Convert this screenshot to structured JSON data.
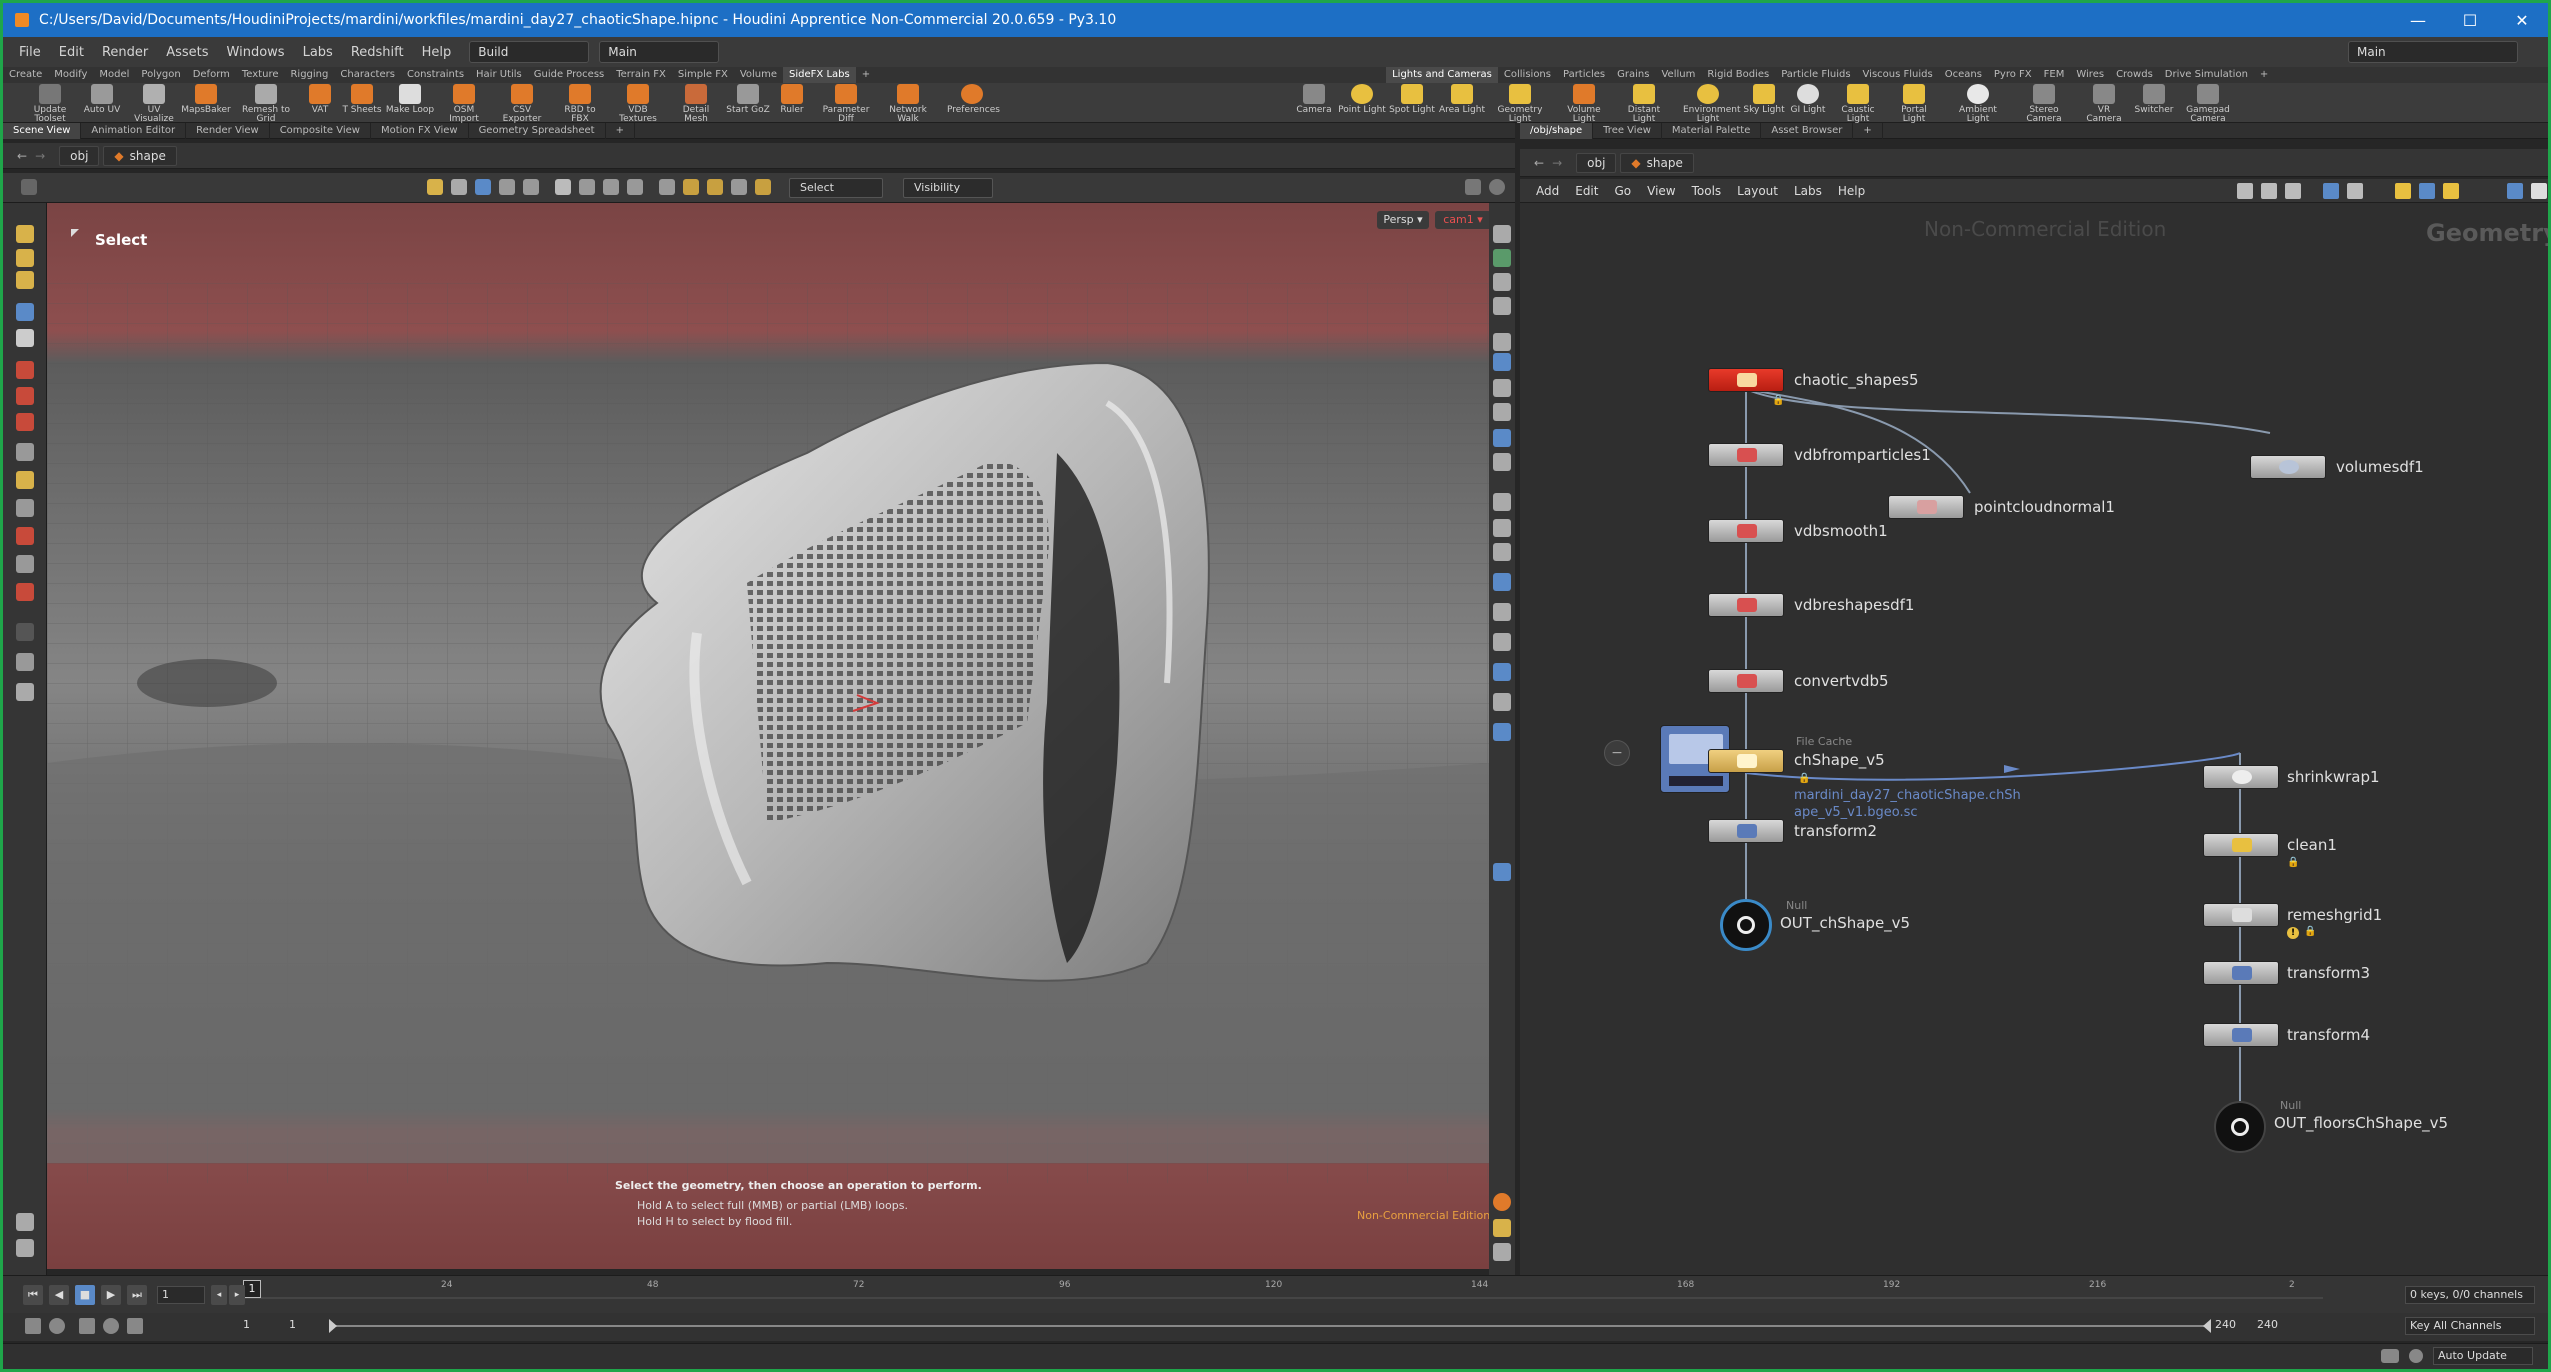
{
  "window": {
    "title": "C:/Users/David/Documents/HoudiniProjects/mardini/workfiles/mardini_day27_chaoticShape.hipnc - Houdini Apprentice Non-Commercial 20.0.659 - Py3.10",
    "minimize": "—",
    "maximize": "☐",
    "close": "✕"
  },
  "menubar": {
    "items": [
      "File",
      "Edit",
      "Render",
      "Assets",
      "Windows",
      "Labs",
      "Redshift",
      "Help"
    ],
    "desktop": "Build",
    "context": "Main",
    "right_context": "Main"
  },
  "shelf": {
    "tabs_left": [
      "Create",
      "Modify",
      "Model",
      "Polygon",
      "Deform",
      "Texture",
      "Rigging",
      "Characters",
      "Constraints",
      "Hair Utils",
      "Guide Process",
      "Terrain FX",
      "Simple FX",
      "Volume",
      "SideFX Labs"
    ],
    "tabs_right": [
      "Lights and Cameras",
      "Collisions",
      "Particles",
      "Grains",
      "Vellum",
      "Rigid Bodies",
      "Particle Fluids",
      "Viscous Fluids",
      "Oceans",
      "Pyro FX",
      "FEM",
      "Wires",
      "Crowds",
      "Drive Simulation"
    ],
    "tools_left": [
      "Update Toolset",
      "Auto UV",
      "UV Visualize",
      "MapsBaker",
      "Remesh to Grid",
      "VAT",
      "T Sheets",
      "Make Loop",
      "OSM Import",
      "CSV Exporter",
      "RBD to FBX",
      "VDB Textures",
      "Detail Mesh",
      "Start GoZ",
      "Ruler",
      "Parameter Diff",
      "Network Walk",
      "Preferences"
    ],
    "tools_right": [
      "Camera",
      "Point Light",
      "Spot Light",
      "Area Light",
      "Geometry Light",
      "Volume Light",
      "Distant Light",
      "Environment Light",
      "Sky Light",
      "GI Light",
      "Caustic Light",
      "Portal Light",
      "Ambient Light",
      "Stereo Camera",
      "VR Camera",
      "Switcher",
      "Gamepad Camera"
    ]
  },
  "left_pane": {
    "tabs": [
      "Scene View",
      "Animation Editor",
      "Render View",
      "Composite View",
      "Motion FX View",
      "Geometry Spreadsheet"
    ],
    "path": [
      "obj",
      "shape"
    ],
    "select_mode": "Select",
    "visibility": "Visibility",
    "tool_label": "Select",
    "persp": "Persp",
    "cam": "cam1",
    "hint_main": "Select the geometry, then choose an operation to perform.",
    "hint_1": "Hold A to select full (MMB) or partial (LMB) loops.",
    "hint_2": "Hold H to select by flood fill.",
    "watermark": "Non-Commercial Edition"
  },
  "right_pane": {
    "tabs": [
      "/obj/shape",
      "Tree View",
      "Material Palette",
      "Asset Browser"
    ],
    "path": [
      "obj",
      "shape"
    ],
    "menu": [
      "Add",
      "Edit",
      "Go",
      "View",
      "Tools",
      "Layout",
      "Labs",
      "Help"
    ],
    "watermark": "Non-Commercial Edition",
    "context_label": "Geometry",
    "nodes": {
      "chaotic_shapes5": "chaotic_shapes5",
      "vdbfromparticles1": "vdbfromparticles1",
      "volumesdf1": "volumesdf1",
      "pointcloudnormal1": "pointcloudnormal1",
      "vdbsmooth1": "vdbsmooth1",
      "vdbreshapesdf1": "vdbreshapesdf1",
      "convertvdb5": "convertvdb5",
      "filecache_type": "File Cache",
      "chShape_v5": "chShape_v5",
      "cache_file_1": "mardini_day27_chaoticShape.chSh",
      "cache_file_2": "ape_v5_v1.bgeo.sc",
      "transform2": "transform2",
      "null_type_1": "Null",
      "out_chshape": "OUT_chShape_v5",
      "shrinkwrap1": "shrinkwrap1",
      "clean1": "clean1",
      "remeshgrid1": "remeshgrid1",
      "transform3": "transform3",
      "transform4": "transform4",
      "null_type_2": "Null",
      "out_floors": "OUT_floorsChShape_v5"
    }
  },
  "timeline": {
    "current_frame": "1",
    "marker": "1",
    "ticks": [
      "24",
      "48",
      "72",
      "96",
      "120",
      "144",
      "168",
      "192",
      "216",
      "2"
    ],
    "range_start": "1",
    "range_start2": "1",
    "range_end": "240",
    "range_end2": "240",
    "keys": "0 keys, 0/0 channels",
    "key_all": "Key All Channels",
    "auto_update": "Auto Update"
  },
  "colors": {
    "titlebar": "#1d6fc5",
    "border": "#1fa64a",
    "accent_orange": "#e8a040",
    "node_red": "#d42a1e",
    "cache_yellow": "#e8c060"
  }
}
